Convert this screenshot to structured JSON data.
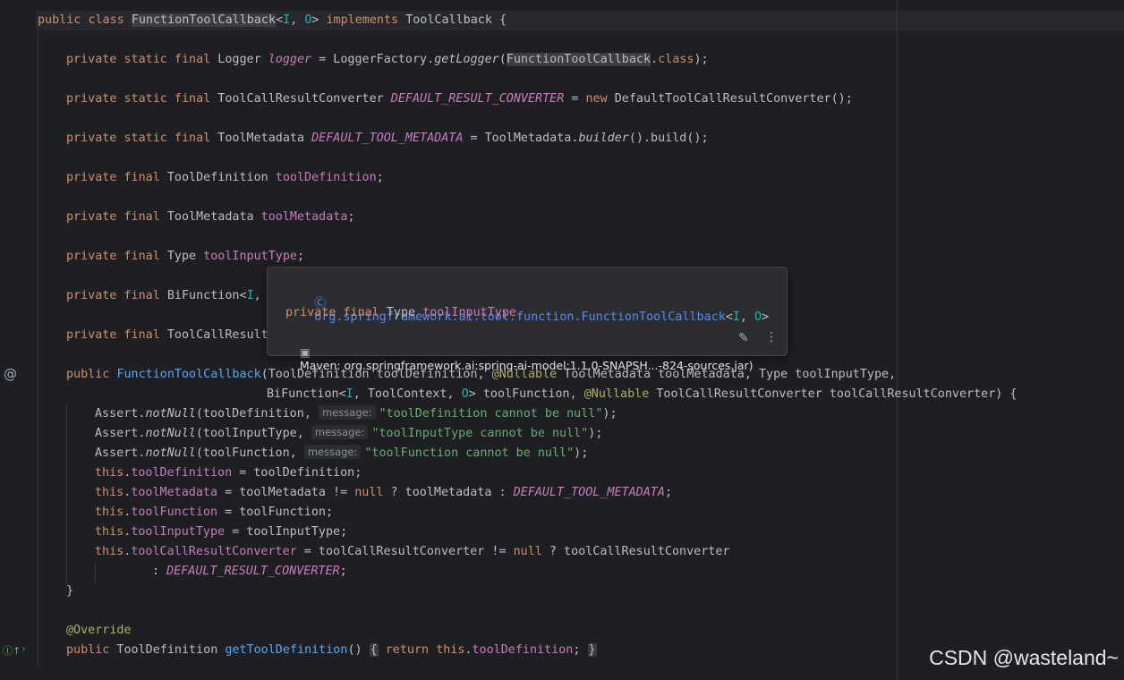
{
  "code": {
    "class_decl": {
      "kw1": "public",
      "kw2": "class",
      "name": "FunctionToolCallback",
      "lt": "<",
      "tI": "I",
      "comma": ", ",
      "tO": "O",
      "gt": ">",
      "kw3": "implements",
      "iface": "ToolCallback",
      "brace": " {"
    },
    "logger": {
      "mods": "private static final",
      "type": " Logger ",
      "field": "logger",
      "eq": " = LoggerFactory.",
      "method": "getLogger",
      "open": "(",
      "arg": "FunctionToolCallback",
      "dot": ".",
      "cls": "class",
      "close": ");"
    },
    "default_converter": {
      "mods": "private static final",
      "type": " ToolCallResultConverter ",
      "field": "DEFAULT_RESULT_CONVERTER",
      "eq": " = ",
      "new_kw": "new",
      "rest": " DefaultToolCallResultConverter();"
    },
    "default_metadata": {
      "mods": "private static final",
      "type": " ToolMetadata ",
      "field": "DEFAULT_TOOL_METADATA",
      "eq": " = ToolMetadata.",
      "method": "builder",
      "rest": "().build();"
    },
    "f_def": {
      "mods": "private final",
      "type": " ToolDefinition ",
      "field": "toolDefinition",
      "semi": ";"
    },
    "f_meta": {
      "mods": "private final",
      "type": " ToolMetadata ",
      "field": "toolMetadata",
      "semi": ";"
    },
    "f_type": {
      "mods": "private final",
      "type": " Type ",
      "field": "toolInputType",
      "semi": ";"
    },
    "f_func": {
      "mods": "private final",
      "type": " BiFunction<",
      "tI": "I",
      "rest": ", "
    },
    "f_conv": {
      "mods": "private final",
      "type": " ToolCallResult"
    },
    "ctor1": {
      "kw": "public",
      "name": "FunctionToolCallback",
      "p1": "(ToolDefinition toolDefinition, ",
      "ann": "@Nullable",
      "p2": " ToolMetadata toolMetadata, Type toolInputType,"
    },
    "ctor2": {
      "a": "BiFunction<",
      "tI": "I",
      "b": ", ToolContext, ",
      "tO": "O",
      "c": "> toolFunction, ",
      "ann": "@Nullable",
      "d": " ToolCallResultConverter toolCallResultConverter) {"
    },
    "assert1": {
      "a": "Assert.",
      "m": "notNull",
      "b": "(toolDefinition, ",
      "hint": "message:",
      "str": "\"toolDefinition cannot be null\"",
      "c": ");"
    },
    "assert2": {
      "a": "Assert.",
      "m": "notNull",
      "b": "(toolInputType, ",
      "hint": "message:",
      "str": "\"toolInputType cannot be null\"",
      "c": ");"
    },
    "assert3": {
      "a": "Assert.",
      "m": "notNull",
      "b": "(toolFunction, ",
      "hint": "message:",
      "str": "\"toolFunction cannot be null\"",
      "c": ");"
    },
    "a_def": {
      "this": "this",
      "dot": ".",
      "field": "toolDefinition",
      "rest": " = toolDefinition;"
    },
    "a_meta": {
      "this": "this",
      "dot": ".",
      "field": "toolMetadata",
      "r1": " = toolMetadata != ",
      "null": "null",
      "r2": " ? toolMetadata : ",
      "const": "DEFAULT_TOOL_METADATA",
      "semi": ";"
    },
    "a_func": {
      "this": "this",
      "dot": ".",
      "field": "toolFunction",
      "rest": " = toolFunction;"
    },
    "a_type": {
      "this": "this",
      "dot": ".",
      "field": "toolInputType",
      "rest": " = toolInputType;"
    },
    "a_conv": {
      "this": "this",
      "dot": ".",
      "field": "toolCallResultConverter",
      "r1": " = toolCallResultConverter != ",
      "null": "null",
      "r2": " ? toolCallResultConverter"
    },
    "a_conv2": {
      "colon": ": ",
      "const": "DEFAULT_RESULT_CONVERTER",
      "semi": ";"
    },
    "close_brace": "}",
    "override": "@Override",
    "getter": {
      "kw": "public",
      "type": " ToolDefinition ",
      "name": "getToolDefinition",
      "parens": "()",
      "ob": "{",
      "ret": "return",
      "this": "this",
      "dot": ".",
      "field": "toolDefinition",
      "semi": ";",
      "cb": "}"
    }
  },
  "popup": {
    "class_ref": "org.springframework.ai.tool.function.FunctionToolCallback",
    "generics_lt": "<",
    "tI": "I",
    "comma": ", ",
    "tO": "O",
    "generics_gt": ">",
    "decl_mods": "private final",
    "decl_type": " Type ",
    "decl_field": "toolInputType",
    "source": "Maven: org.springframework.ai:spring-ai-model:1.1.0-SNAPSH...-824-sources.jar)"
  },
  "watermark": "CSDN @wasteland~",
  "colors": {
    "background": "#1e1f22",
    "keyword": "#cf8e6d",
    "method": "#56a8f5",
    "field": "#c77dbb",
    "annotation": "#b3ae60",
    "string": "#6aab73",
    "type_param": "#16baac"
  }
}
